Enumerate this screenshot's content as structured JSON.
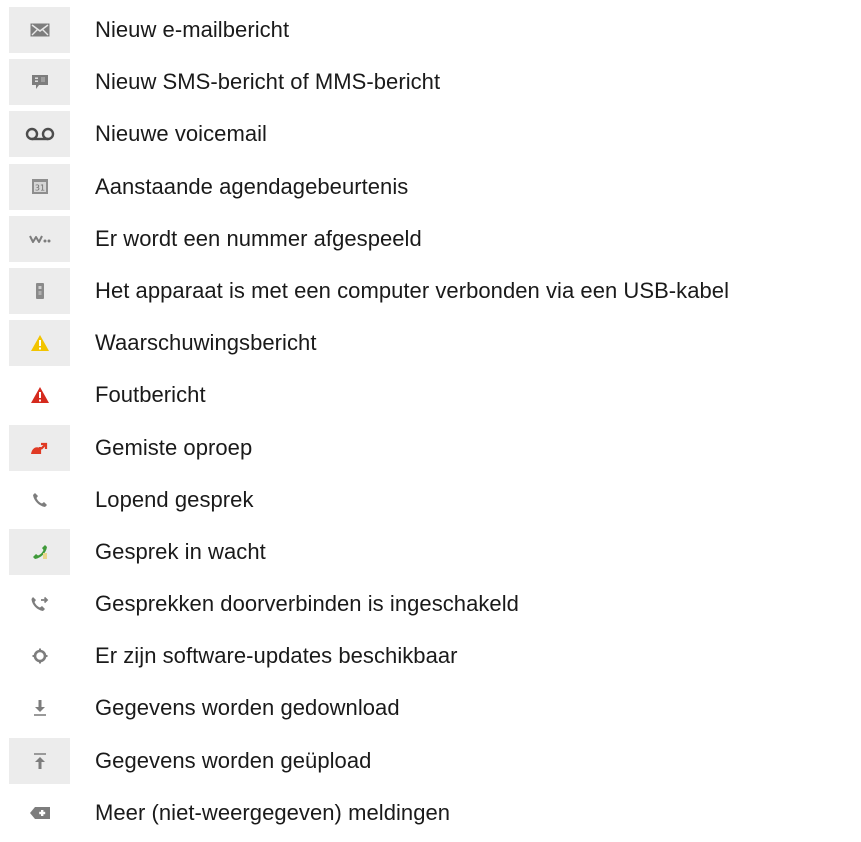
{
  "items": [
    {
      "icon": "new-email-icon",
      "label": "Nieuw e-mailbericht"
    },
    {
      "icon": "new-message-icon",
      "label": "Nieuw SMS-bericht of MMS-bericht"
    },
    {
      "icon": "voicemail-icon",
      "label": "Nieuwe voicemail"
    },
    {
      "icon": "calendar-icon",
      "label": "Aanstaande agendagebeurtenis"
    },
    {
      "icon": "music-playing-icon",
      "label": "Er wordt een nummer afgespeeld"
    },
    {
      "icon": "usb-icon",
      "label": "Het apparaat is met een computer verbonden via een USB-kabel"
    },
    {
      "icon": "warning-icon",
      "label": "Waarschuwingsbericht"
    },
    {
      "icon": "error-icon",
      "label": "Foutbericht"
    },
    {
      "icon": "missed-call-icon",
      "label": "Gemiste oproep"
    },
    {
      "icon": "ongoing-call-icon",
      "label": "Lopend gesprek"
    },
    {
      "icon": "call-on-hold-icon",
      "label": "Gesprek in wacht"
    },
    {
      "icon": "call-forwarding-icon",
      "label": "Gesprekken doorverbinden is ingeschakeld"
    },
    {
      "icon": "software-update-icon",
      "label": "Er zijn software-updates beschikbaar"
    },
    {
      "icon": "downloading-icon",
      "label": "Gegevens worden gedownload"
    },
    {
      "icon": "uploading-icon",
      "label": "Gegevens worden geüpload"
    },
    {
      "icon": "more-notifications-icon",
      "label": "Meer (niet-weergegeven) meldingen"
    }
  ],
  "colors": {
    "icon_gray": "#8a8a8a",
    "warning_yellow": "#f2c400",
    "error_red": "#d52a1e",
    "missed_call_red": "#e03a24",
    "hold_green": "#3f9a3a"
  }
}
